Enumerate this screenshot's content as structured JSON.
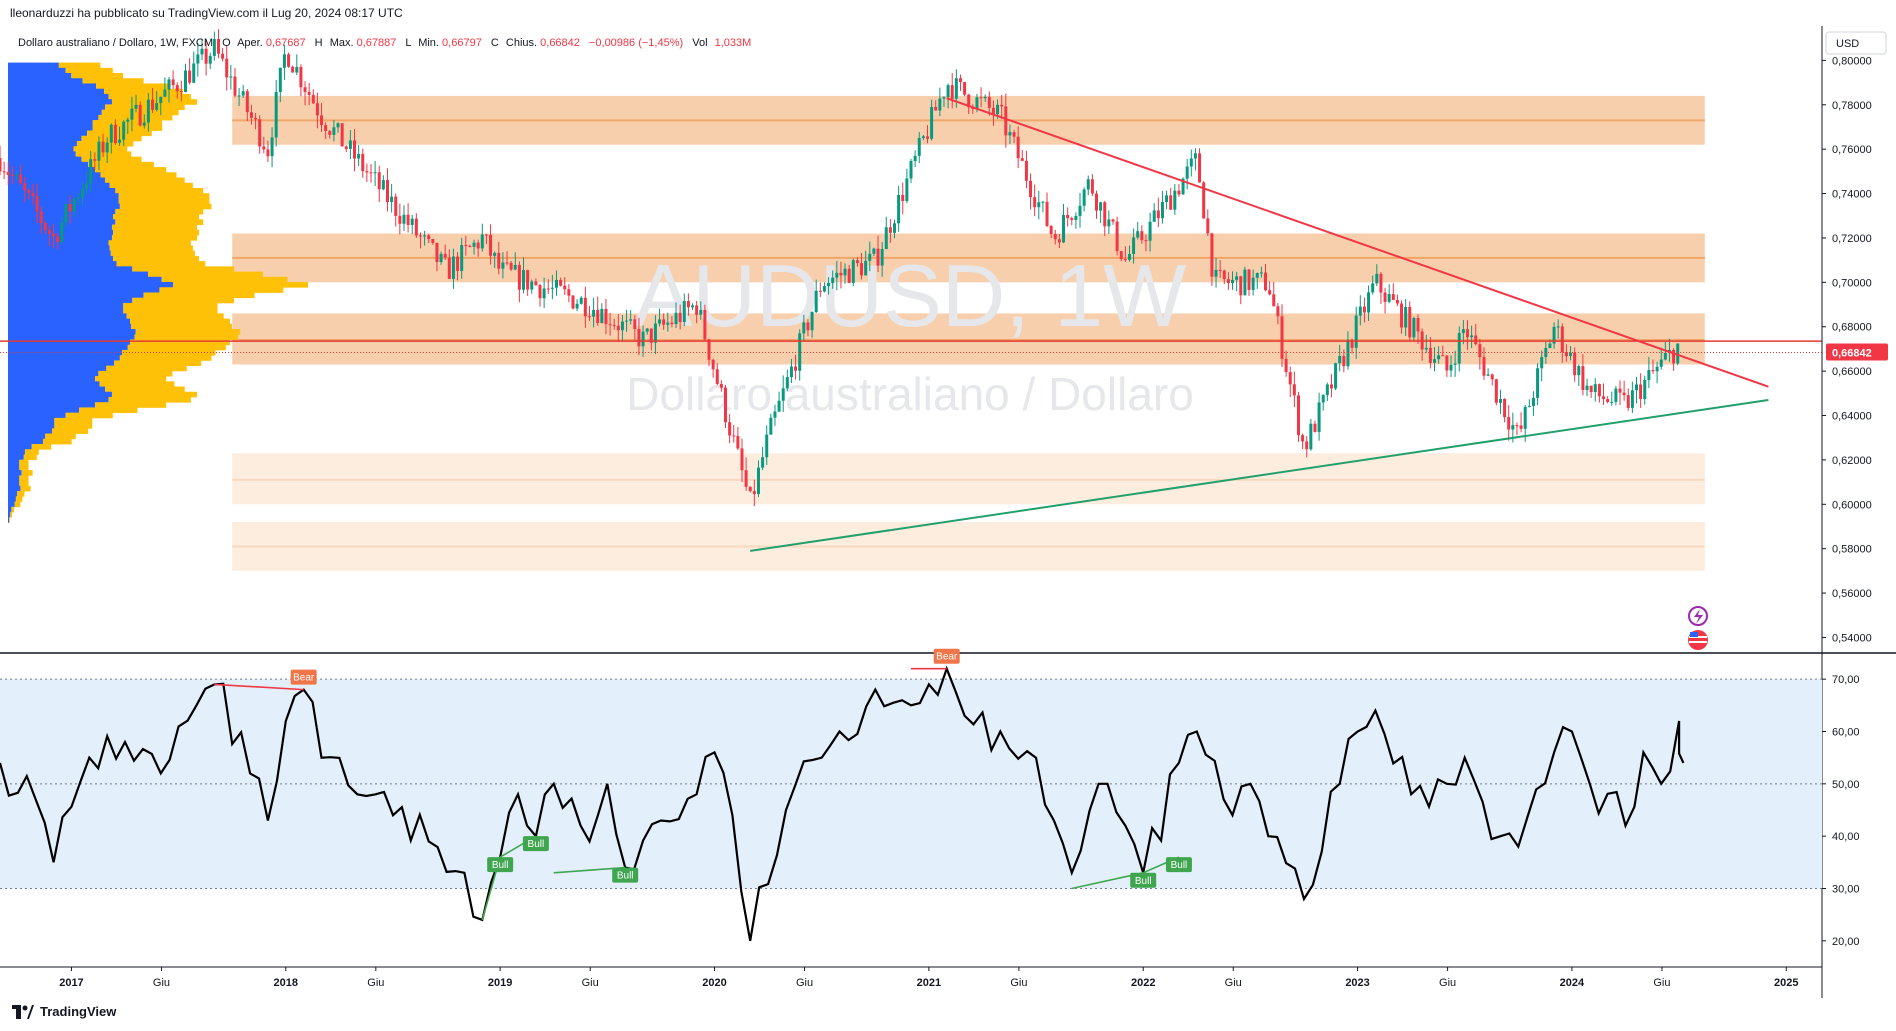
{
  "header": {
    "published_by": "lleonarduzzi ha pubblicato su TradingView.com il Lug 20, 2024 08:17 UTC"
  },
  "legend": {
    "symbol": "Dollaro australiano / Dollaro, 1W, FXCM",
    "open_label": "O",
    "open_text": "Aper.",
    "open_value": "0,67687",
    "high_label": "H",
    "high_text": "Max.",
    "high_value": "0,67887",
    "low_label": "L",
    "low_text": "Min.",
    "low_value": "0,66797",
    "close_label": "C",
    "close_text": "Chius.",
    "close_value": "0,66842",
    "change_value": "−0,00986 (−1,45%)",
    "vol_label": "Vol",
    "vol_value": "1,033M"
  },
  "watermark": {
    "ticker": "AUDUSD, 1W",
    "name": "Dollaro australiano / Dollaro"
  },
  "price_axis": {
    "currency": "USD",
    "ticks": [
      "0,80000",
      "0,78000",
      "0,76000",
      "0,74000",
      "0,72000",
      "0,70000",
      "0,68000",
      "0,66000",
      "0,64000",
      "0,62000",
      "0,60000",
      "0,58000",
      "0,56000",
      "0,54000"
    ],
    "last_price_label": "0,66842"
  },
  "rsi_axis": {
    "ticks": [
      "70,00",
      "60,00",
      "50,00",
      "40,00",
      "30,00",
      "20,00"
    ]
  },
  "time_axis": {
    "labels": [
      "2017",
      "Giu",
      "2018",
      "Giu",
      "2019",
      "Giu",
      "2020",
      "Giu",
      "2021",
      "Giu",
      "2022",
      "Giu",
      "2023",
      "Giu",
      "2024",
      "Giu",
      "2025"
    ]
  },
  "divergence_labels": {
    "bear": "Bear",
    "bull": "Bull"
  },
  "colors": {
    "up": "#089981",
    "down": "#f23645",
    "zone_strong": "#f7c79e",
    "zone_weak": "#fcebdc",
    "zone_line": "#f0a262",
    "resistance_line": "#f23645",
    "support_line": "#22a06b",
    "last_price_line": "#e53935",
    "rsi_band": "#e3f0fb",
    "rsi_line": "#000000",
    "bear_tag": "#f0764a",
    "bull_tag": "#3fa64f",
    "vp_blue": "#2962ff",
    "vp_yellow": "#ffc107"
  },
  "footer": {
    "brand": "TradingView"
  },
  "chart_data": [
    {
      "type": "candlestick",
      "title": "Dollaro australiano / Dollaro, 1W, FXCM",
      "xlabel": "",
      "ylabel": "",
      "x_range": [
        "2016-09",
        "2025-03"
      ],
      "ylim": [
        0.533,
        0.8155
      ],
      "last_close": 0.66842,
      "price_path": [
        [
          "2016-09",
          0.756
        ],
        [
          "2016-12",
          0.72
        ],
        [
          "2017-03",
          0.765
        ],
        [
          "2017-07",
          0.79
        ],
        [
          "2017-09",
          0.805
        ],
        [
          "2017-12",
          0.76
        ],
        [
          "2018-01",
          0.805
        ],
        [
          "2018-03",
          0.775
        ],
        [
          "2018-07",
          0.735
        ],
        [
          "2018-10",
          0.705
        ],
        [
          "2018-12",
          0.72
        ],
        [
          "2019-01",
          0.705
        ],
        [
          "2019-06",
          0.69
        ],
        [
          "2019-09",
          0.674
        ],
        [
          "2019-12",
          0.69
        ],
        [
          "2020-03",
          0.6
        ],
        [
          "2020-04",
          0.63
        ],
        [
          "2020-07",
          0.7
        ],
        [
          "2020-10",
          0.71
        ],
        [
          "2021-01",
          0.77
        ],
        [
          "2021-02",
          0.79
        ],
        [
          "2021-05",
          0.775
        ],
        [
          "2021-08",
          0.72
        ],
        [
          "2021-10",
          0.745
        ],
        [
          "2021-12",
          0.71
        ],
        [
          "2022-04",
          0.755
        ],
        [
          "2022-05",
          0.7
        ],
        [
          "2022-08",
          0.7
        ],
        [
          "2022-10",
          0.625
        ],
        [
          "2023-02",
          0.7
        ],
        [
          "2023-06",
          0.66
        ],
        [
          "2023-07",
          0.68
        ],
        [
          "2023-10",
          0.63
        ],
        [
          "2023-12",
          0.68
        ],
        [
          "2024-02",
          0.65
        ],
        [
          "2024-04",
          0.645
        ],
        [
          "2024-07",
          0.672
        ]
      ],
      "zones": [
        {
          "low": 0.762,
          "high": 0.784,
          "mid": 0.773,
          "strength": "strong"
        },
        {
          "low": 0.7,
          "high": 0.722,
          "mid": 0.711,
          "strength": "strong"
        },
        {
          "low": 0.663,
          "high": 0.686,
          "mid": 0.674,
          "strength": "strong"
        },
        {
          "low": 0.6,
          "high": 0.623,
          "mid": 0.611,
          "strength": "weak"
        },
        {
          "low": 0.57,
          "high": 0.592,
          "mid": 0.581,
          "strength": "weak"
        }
      ],
      "trendlines": [
        {
          "name": "",
          "points": [
            [
              "2021-02",
              0.783
            ],
            [
              "2024-12",
              0.653
            ]
          ]
        },
        {
          "name": "",
          "points": [
            [
              "2020-03",
              0.579
            ],
            [
              "2024-12",
              0.647
            ]
          ]
        }
      ],
      "horizontal_lines": [
        0.6735
      ]
    },
    {
      "type": "line",
      "title": "",
      "ylim": [
        15,
        75
      ],
      "band": [
        30,
        70
      ],
      "midline": 50,
      "series": [
        {
          "name": "",
          "points": [
            [
              "2016-09",
              54
            ],
            [
              "2016-11",
              47
            ],
            [
              "2016-12",
              35
            ],
            [
              "2017-02",
              55
            ],
            [
              "2017-04",
              58
            ],
            [
              "2017-06",
              52
            ],
            [
              "2017-08",
              65
            ],
            [
              "2017-09",
              69
            ],
            [
              "2017-11",
              52
            ],
            [
              "2017-12",
              43
            ],
            [
              "2018-01",
              62
            ],
            [
              "2018-02",
              68
            ],
            [
              "2018-03",
              55
            ],
            [
              "2018-05",
              48
            ],
            [
              "2018-07",
              44
            ],
            [
              "2018-09",
              39
            ],
            [
              "2018-11",
              33
            ],
            [
              "2018-12",
              24
            ],
            [
              "2019-01",
              36
            ],
            [
              "2019-02",
              48
            ],
            [
              "2019-03",
              40
            ],
            [
              "2019-04",
              50
            ],
            [
              "2019-06",
              39
            ],
            [
              "2019-07",
              50
            ],
            [
              "2019-08",
              34
            ],
            [
              "2019-10",
              43
            ],
            [
              "2019-12",
              48
            ],
            [
              "2020-01",
              56
            ],
            [
              "2020-02",
              44
            ],
            [
              "2020-03",
              20
            ],
            [
              "2020-05",
              45
            ],
            [
              "2020-07",
              55
            ],
            [
              "2020-08",
              60
            ],
            [
              "2020-10",
              68
            ],
            [
              "2020-12",
              65
            ],
            [
              "2021-01",
              69
            ],
            [
              "2021-02",
              72
            ],
            [
              "2021-03",
              63
            ],
            [
              "2021-05",
              60
            ],
            [
              "2021-07",
              55
            ],
            [
              "2021-08",
              43
            ],
            [
              "2021-09",
              33
            ],
            [
              "2021-11",
              50
            ],
            [
              "2021-12",
              42
            ],
            [
              "2022-01",
              33
            ],
            [
              "2022-03",
              54
            ],
            [
              "2022-04",
              60
            ],
            [
              "2022-06",
              44
            ],
            [
              "2022-07",
              50
            ],
            [
              "2022-08",
              40
            ],
            [
              "2022-10",
              28
            ],
            [
              "2022-12",
              50
            ],
            [
              "2023-01",
              60
            ],
            [
              "2023-02",
              64
            ],
            [
              "2023-04",
              48
            ],
            [
              "2023-06",
              50
            ],
            [
              "2023-07",
              55
            ],
            [
              "2023-09",
              40
            ],
            [
              "2023-10",
              38
            ],
            [
              "2023-12",
              56
            ],
            [
              "2024-01",
              60
            ],
            [
              "2024-02",
              50
            ],
            [
              "2024-04",
              42
            ],
            [
              "2024-05",
              56
            ],
            [
              "2024-06",
              50
            ],
            [
              "2024-07",
              62
            ],
            [
              "2024-07",
              54
            ]
          ]
        }
      ],
      "divergences": [
        {
          "type": "Bear",
          "points": [
            [
              "2017-09",
              69
            ],
            [
              "2018-02",
              68
            ]
          ]
        },
        {
          "type": "Bull",
          "points": [
            [
              "2018-12",
              24
            ],
            [
              "2019-01",
              36
            ]
          ]
        },
        {
          "type": "Bull",
          "points": [
            [
              "2019-01",
              36
            ],
            [
              "2019-03",
              40
            ]
          ]
        },
        {
          "type": "Bull",
          "points": [
            [
              "2019-04",
              33
            ],
            [
              "2019-08",
              34
            ]
          ]
        },
        {
          "type": "Bear",
          "points": [
            [
              "2020-12",
              72
            ],
            [
              "2021-02",
              72
            ]
          ]
        },
        {
          "type": "Bull",
          "points": [
            [
              "2021-09",
              30
            ],
            [
              "2022-01",
              33
            ]
          ]
        },
        {
          "type": "Bull",
          "points": [
            [
              "2022-01",
              33
            ],
            [
              "2022-03",
              36
            ]
          ]
        }
      ]
    }
  ]
}
